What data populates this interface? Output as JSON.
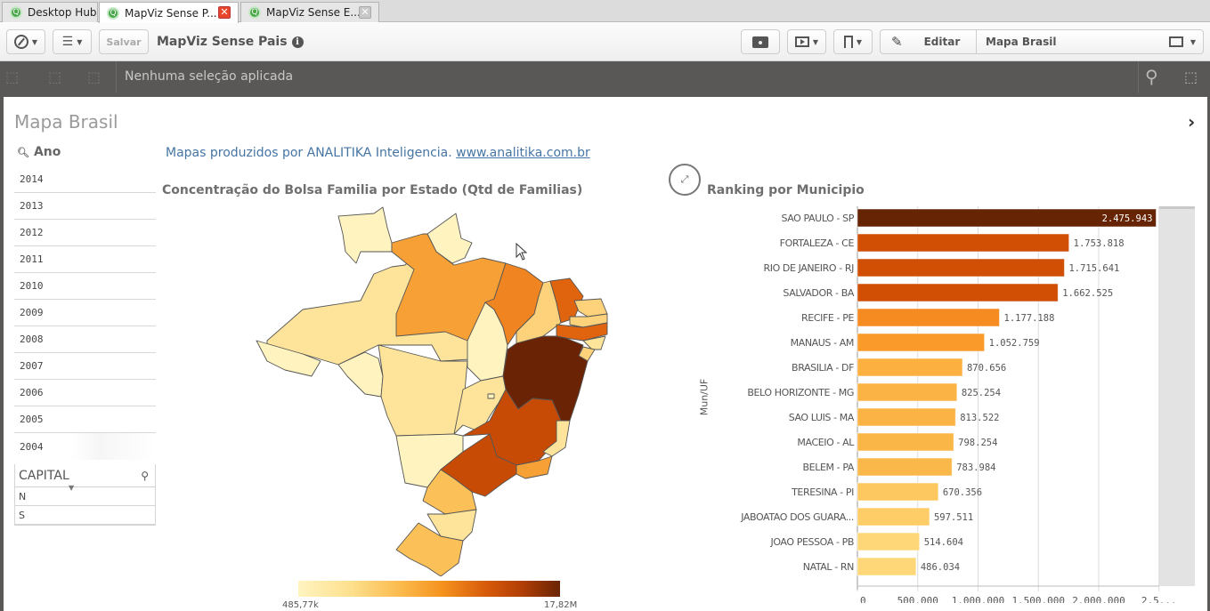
{
  "tabs": [
    {
      "label": "Desktop Hub",
      "active": false,
      "closable": false
    },
    {
      "label": "MapViz Sense P...",
      "active": true,
      "closable": true
    },
    {
      "label": "MapViz Sense E...",
      "active": false,
      "closable": true
    }
  ],
  "toolbar": {
    "navigate_icon": "compass-icon",
    "list_icon": "list-icon",
    "save_label": "Salvar",
    "app_title": "MapViz Sense Pais",
    "snapshot_icon": "camera-icon",
    "present_icon": "presentation-icon",
    "bookmark_icon": "bookmark-icon",
    "edit_label": "Editar",
    "sheet_name": "Mapa Brasil",
    "sheets_icon": "sheets-icon"
  },
  "selections": {
    "text": "Nenhuma seleção aplicada"
  },
  "sheet": {
    "title": "Mapa Brasil"
  },
  "ano_filter": {
    "title": "Ano",
    "items": [
      "2014",
      "2013",
      "2012",
      "2011",
      "2010",
      "2009",
      "2008",
      "2007",
      "2006",
      "2005",
      "2004"
    ]
  },
  "capital_filter": {
    "title": "CAPITAL",
    "items": [
      "N",
      "S"
    ]
  },
  "credit": {
    "text": "Mapas produzidos por ANALITIKA Inteligencia. ",
    "link": "www.analitika.com.br"
  },
  "map": {
    "title": "Concentração do Bolsa Familia por Estado (Qtd de Familias)",
    "legend_min": "485,77k",
    "legend_max": "17,82M",
    "colors": {
      "lightest": "#fff4c0",
      "light": "#fde49a",
      "light2": "#fdd27a",
      "mid": "#fbc158",
      "orange": "#f7a035",
      "orange2": "#ef8420",
      "dark_orange": "#e0640e",
      "red_orange": "#c84b05",
      "darkest": "#6a2405"
    }
  },
  "chart_data": {
    "type": "bar",
    "orientation": "horizontal",
    "title": "Ranking por Municipio",
    "ylabel": "Mun/UF",
    "xlabel": "",
    "xlim": [
      0,
      2500000
    ],
    "xticks": [
      "0",
      "500.000",
      "1.000.000",
      "1.500.000",
      "2.000.000",
      "2.5..."
    ],
    "grid": true,
    "categories": [
      "SAO PAULO - SP",
      "FORTALEZA - CE",
      "RIO DE JANEIRO - RJ",
      "SALVADOR - BA",
      "RECIFE - PE",
      "MANAUS - AM",
      "BRASILIA - DF",
      "BELO HORIZONTE - MG",
      "SAO LUIS - MA",
      "MACEIO - AL",
      "BELEM - PA",
      "TERESINA - PI",
      "JABOATAO DOS GUARA...",
      "JOAO PESSOA - PB",
      "NATAL - RN"
    ],
    "values": [
      2475943,
      1753818,
      1715641,
      1662525,
      1177188,
      1052759,
      870656,
      825254,
      813522,
      798254,
      783984,
      670356,
      597511,
      514604,
      486034
    ],
    "labels": [
      "2.475.943",
      "1.753.818",
      "1.715.641",
      "1.662.525",
      "1.177.188",
      "1.052.759",
      "870.656",
      "825.254",
      "813.522",
      "798.254",
      "783.984",
      "670.356",
      "597.511",
      "514.604",
      "486.034"
    ],
    "colors": [
      "#662405",
      "#d04f04",
      "#d04f04",
      "#d04f04",
      "#f68b21",
      "#f99a2b",
      "#fbb040",
      "#fbb346",
      "#fbb346",
      "#fbb648",
      "#fbb84a",
      "#fdc860",
      "#fecd68",
      "#fed878",
      "#fed878"
    ]
  }
}
